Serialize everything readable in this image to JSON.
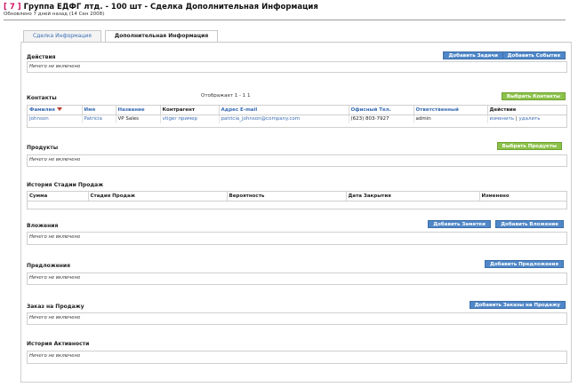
{
  "header": {
    "record_id": "[ 7 ]",
    "title": "Группа ЕДФГ лтд. - 100 шт - Сделка Дополнительная Информация",
    "updated": "Обновлено 7 дней назад (14 Сен 2008)"
  },
  "tabs": [
    {
      "label": "Сделка Информация",
      "active": false
    },
    {
      "label": "Дополнительная Информация",
      "active": true
    }
  ],
  "empty_text": "Ничего не включено",
  "actions": {
    "title": "Действия",
    "add_task": "Добавить Задачи",
    "add_event": "Добавить События"
  },
  "contacts": {
    "title": "Контакты",
    "paging": "Отображает 1 - 1 1",
    "select_button": "Выбрать Контакты",
    "columns": [
      "Фамилия",
      "Имя",
      "Название",
      "Контрагент",
      "Адрес E-mail",
      "Офисный Тел.",
      "Ответственный",
      "Действие"
    ],
    "rows": [
      {
        "last": "Johnson",
        "first": "Patricia",
        "title": "VP Sales",
        "account": "vtiger пример",
        "email": "patricia_johnson@company.com",
        "phone": "(623) 803-7927",
        "owner": "admin",
        "edit": "изменить",
        "sep": "|",
        "del": "удалить"
      }
    ]
  },
  "products": {
    "title": "Продукты",
    "select_button": "Выбрать Продукты"
  },
  "stage_history": {
    "title": "История Стадии Продаж",
    "columns": [
      "Сумма",
      "Стадия Продаж",
      "Вероятность",
      "Дата Закрытия",
      "Изменено"
    ]
  },
  "attachments": {
    "title": "Вложения",
    "add_note": "Добавить Заметки",
    "add_attachment": "Добавить Вложение"
  },
  "quotes": {
    "title": "Предложения",
    "add_quote": "Добавить Предложения"
  },
  "sales_orders": {
    "title": "Заказ на Продажу",
    "add_order": "Добавить Заказы на Продажу"
  },
  "activity_history": {
    "title": "История Активности"
  }
}
